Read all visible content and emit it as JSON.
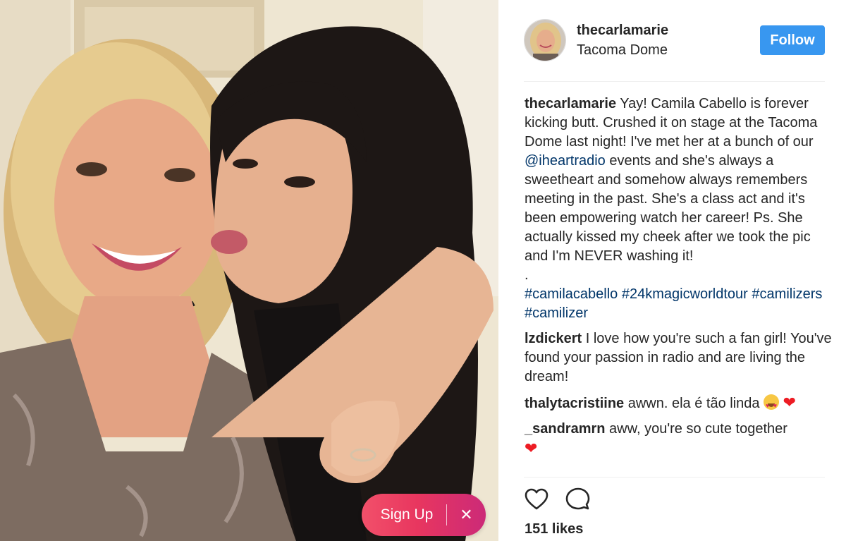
{
  "post": {
    "username": "thecarlamarie",
    "location": "Tacoma Dome",
    "follow_label": "Follow"
  },
  "caption": {
    "user": "thecarlamarie",
    "text_1": " Yay! Camila Cabello is forever kicking butt. Crushed it on stage at the Tacoma Dome last night! I've met her at a bunch of our ",
    "mention": "@iheartradio",
    "text_2": " events and she's always a sweetheart and somehow always remembers meeting in the past. She's a class act and it's been empowering watch her career! Ps. She actually kissed my cheek after we took the pic and I'm NEVER washing it!",
    "dot": ".",
    "hashtags": [
      "#camilacabello",
      "#24kmagicworldtour",
      "#camilizers",
      "#camilizer"
    ]
  },
  "comments": [
    {
      "user": "lzdickert",
      "text": " I love how you're such a fan girl! You've found your passion in radio and are living the dream!"
    },
    {
      "user": "thalytacristiine",
      "text": " awwn. ela é tão linda "
    },
    {
      "user": "_sandramrn",
      "text": " aww, you're so cute together"
    }
  ],
  "emoji": {
    "heart": "❤"
  },
  "likes_label": "151 likes",
  "signup": {
    "label": "Sign Up",
    "close": "✕"
  },
  "icons": {
    "like": "heart-outline-icon",
    "comment": "speech-bubble-icon",
    "close": "close-icon"
  },
  "colors": {
    "accent": "#3897f0",
    "link": "#003569",
    "signup_start": "#f2506a",
    "signup_end": "#cc2a78"
  }
}
